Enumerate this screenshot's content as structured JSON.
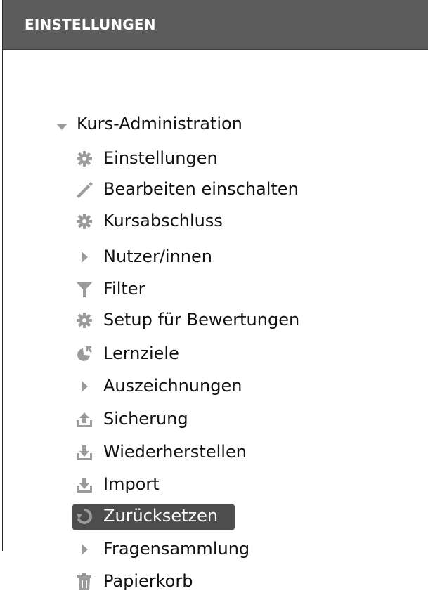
{
  "block": {
    "title": "EINSTELLUNGEN"
  },
  "tree": {
    "root": {
      "label": "Kurs-Administration",
      "expanded": true
    },
    "items": [
      {
        "label": "Einstellungen",
        "icon": "gear-icon"
      },
      {
        "label": "Bearbeiten einschalten",
        "icon": "pencil-icon"
      },
      {
        "label": "Kursabschluss",
        "icon": "gear-icon"
      },
      {
        "label": "Nutzer/innen",
        "icon": "caret-right-icon"
      },
      {
        "label": "Filter",
        "icon": "filter-icon"
      },
      {
        "label": "Setup für Bewertungen",
        "icon": "gear-icon"
      },
      {
        "label": "Lernziele",
        "icon": "competency-icon"
      },
      {
        "label": "Auszeichnungen",
        "icon": "caret-right-icon"
      },
      {
        "label": "Sicherung",
        "icon": "upload-icon"
      },
      {
        "label": "Wiederherstellen",
        "icon": "download-icon"
      },
      {
        "label": "Import",
        "icon": "download-icon"
      },
      {
        "label": "Zurücksetzen",
        "icon": "reset-icon",
        "active": true
      },
      {
        "label": "Fragensammlung",
        "icon": "caret-right-icon"
      },
      {
        "label": "Papierkorb",
        "icon": "trash-icon"
      }
    ]
  },
  "colors": {
    "header_bg": "#5c5c5c",
    "header_text": "#ffffff",
    "icon": "#9b9b9b",
    "active_bg": "#4d4d4d",
    "active_text": "#ffffff"
  }
}
